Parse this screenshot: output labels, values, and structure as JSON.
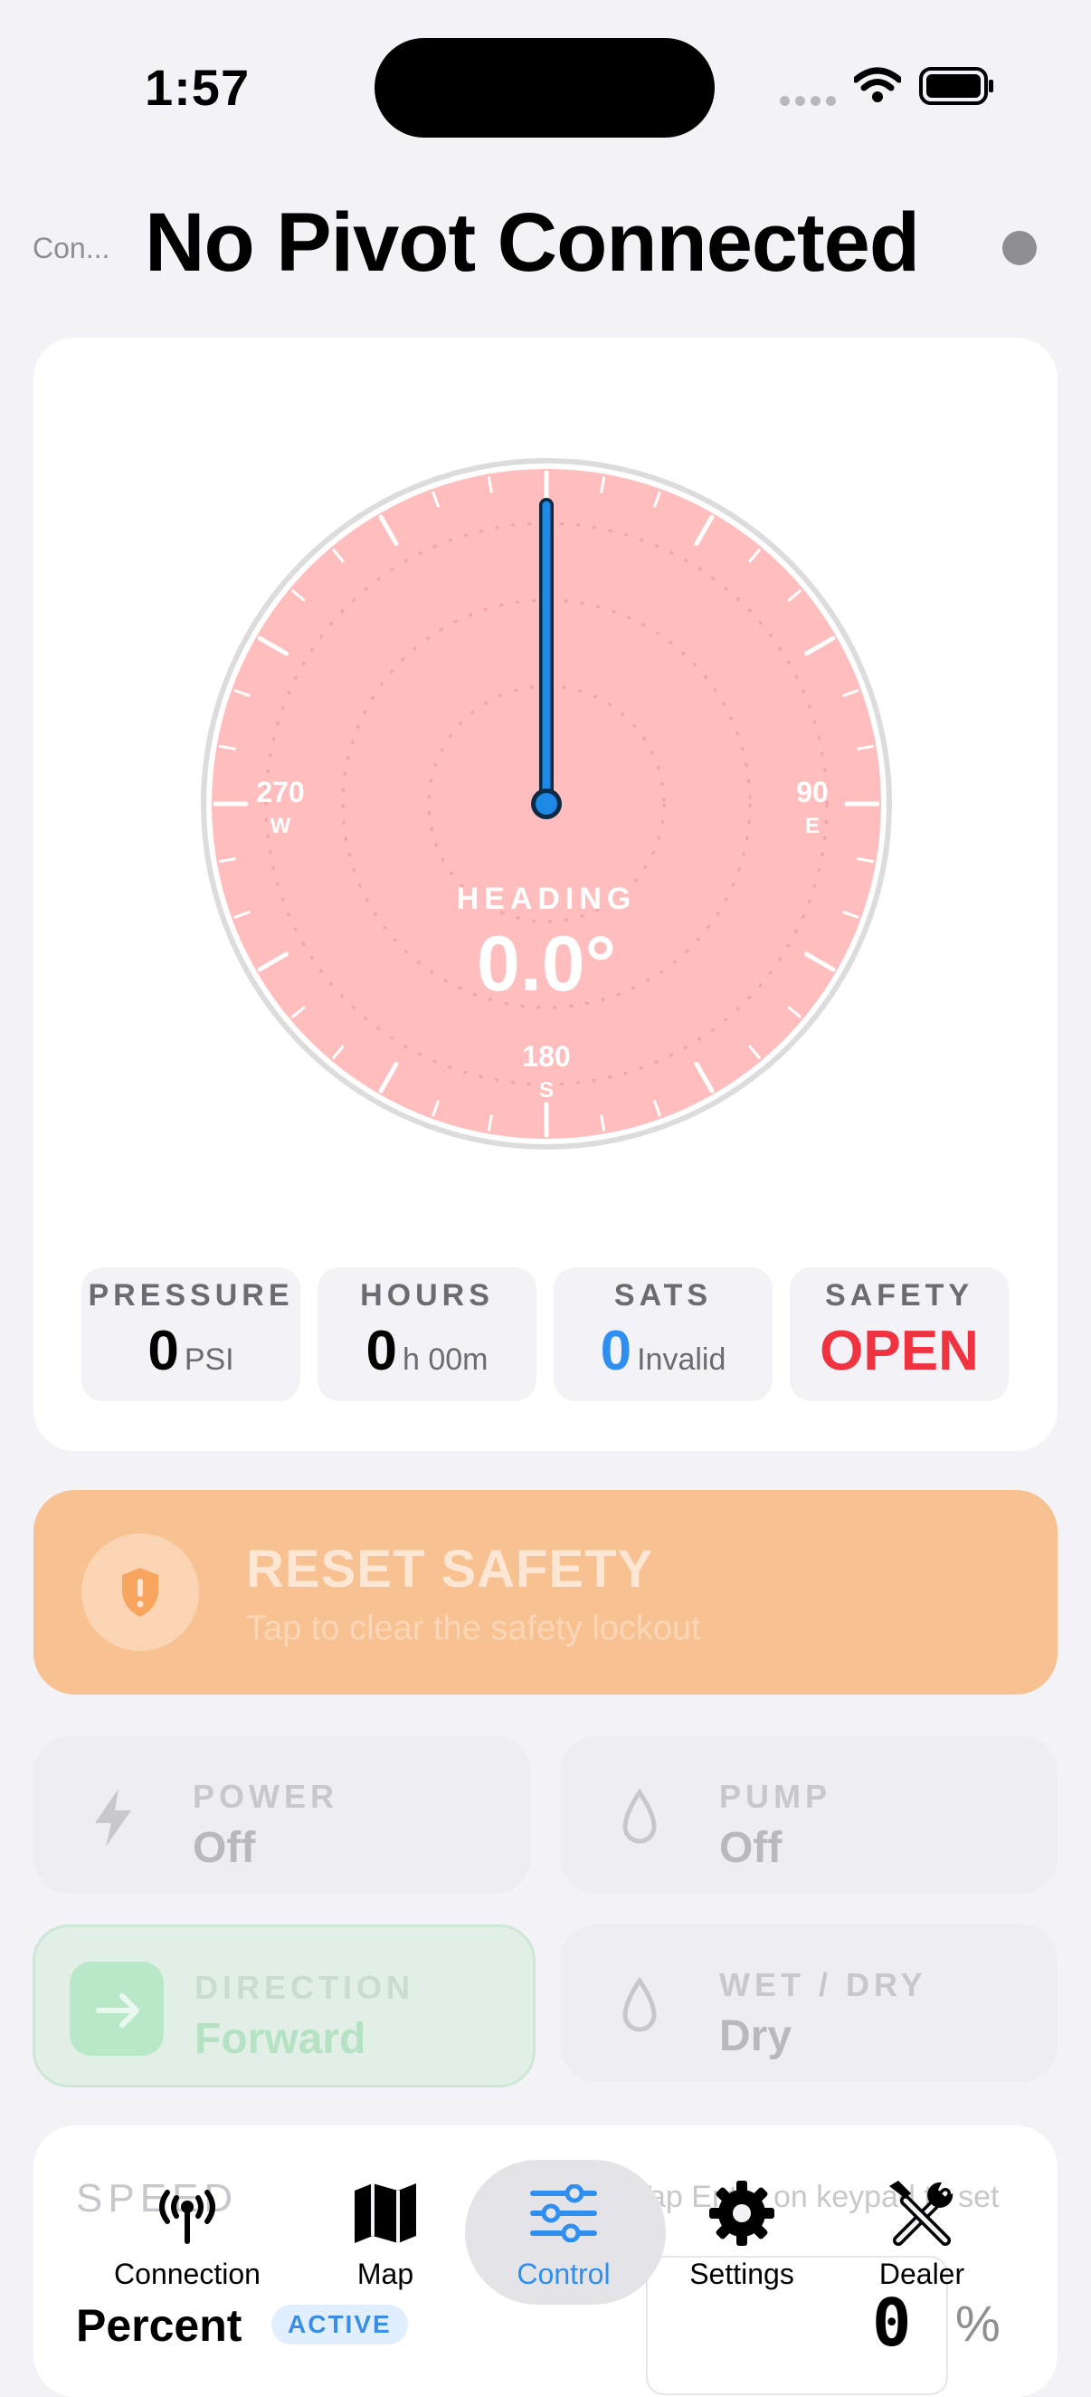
{
  "status_bar": {
    "time": "1:57"
  },
  "header": {
    "connection_label": "Con...",
    "title": "No Pivot Connected"
  },
  "compass": {
    "heading_label": "HEADING",
    "heading_value": "0.0°",
    "needle_heading_deg": 0,
    "marks": [
      {
        "deg": "270",
        "dir": "W"
      },
      {
        "deg": "90",
        "dir": "E"
      },
      {
        "deg": "180",
        "dir": "S"
      }
    ]
  },
  "stats": [
    {
      "label": "PRESSURE",
      "value": "0",
      "unit": "PSI"
    },
    {
      "label": "HOURS",
      "value": "0",
      "unit": "h 00m"
    },
    {
      "label": "SATS",
      "value": "0",
      "unit": "Invalid"
    },
    {
      "label": "SAFETY",
      "value": "OPEN",
      "unit": ""
    }
  ],
  "reset_safety": {
    "title": "RESET SAFETY",
    "subtitle": "Tap to clear the safety lockout"
  },
  "controls": {
    "power": {
      "label": "POWER",
      "value": "Off"
    },
    "pump": {
      "label": "PUMP",
      "value": "Off"
    },
    "direction": {
      "label": "DIRECTION",
      "value": "Forward"
    },
    "wet_dry": {
      "label": "WET / DRY",
      "value": "Dry"
    }
  },
  "speed": {
    "label": "SPEED",
    "hint": "Tap Enter on keypad to set",
    "mode": "Percent",
    "badge": "ACTIVE",
    "value": "0",
    "unit": "%"
  },
  "tab_bar": {
    "selected": "Control",
    "tabs": [
      {
        "label": "Connection",
        "icon": "antenna-icon"
      },
      {
        "label": "Map",
        "icon": "map-icon"
      },
      {
        "label": "Control",
        "icon": "sliders-icon"
      },
      {
        "label": "Settings",
        "icon": "gear-icon"
      },
      {
        "label": "Dealer",
        "icon": "tools-icon"
      }
    ]
  },
  "colors": {
    "dial": "#ffbdbd",
    "needle": "#1e88e5",
    "safety_open": "#ef3340",
    "sats_value": "#2e8ff0",
    "reset_bg": "#f8c192",
    "accent": "#2e8ff0"
  }
}
